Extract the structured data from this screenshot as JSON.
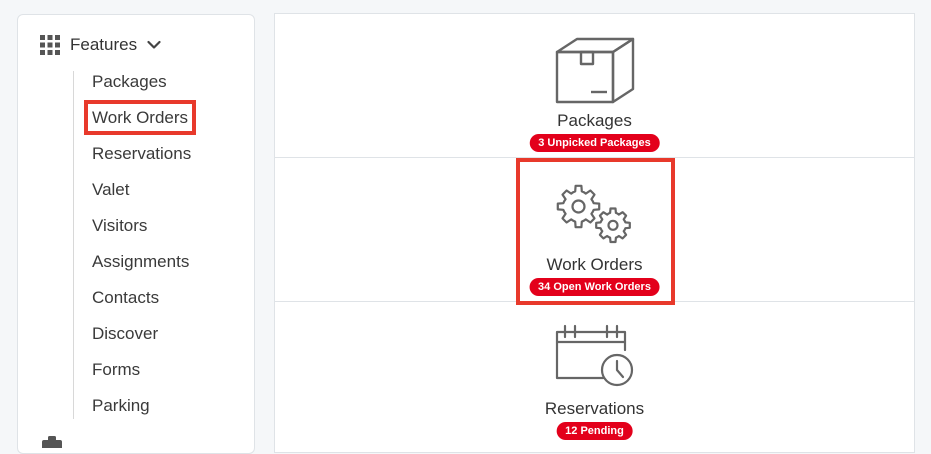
{
  "sidebar": {
    "header_label": "Features",
    "items": [
      {
        "label": "Packages"
      },
      {
        "label": "Work Orders",
        "highlighted": true
      },
      {
        "label": "Reservations"
      },
      {
        "label": "Valet"
      },
      {
        "label": "Visitors"
      },
      {
        "label": "Assignments"
      },
      {
        "label": "Contacts"
      },
      {
        "label": "Discover"
      },
      {
        "label": "Forms"
      },
      {
        "label": "Parking"
      }
    ]
  },
  "cards": [
    {
      "label": "Packages",
      "badge": "3 Unpicked Packages",
      "icon": "package-box-icon"
    },
    {
      "label": "Work Orders",
      "badge": "34 Open Work Orders",
      "icon": "gears-icon",
      "highlighted": true
    },
    {
      "label": "Reservations",
      "badge": "12 Pending",
      "icon": "calendar-clock-icon"
    }
  ],
  "colors": {
    "badge": "#e3001b",
    "highlight": "#e8392b",
    "icon_stroke": "#666666"
  }
}
